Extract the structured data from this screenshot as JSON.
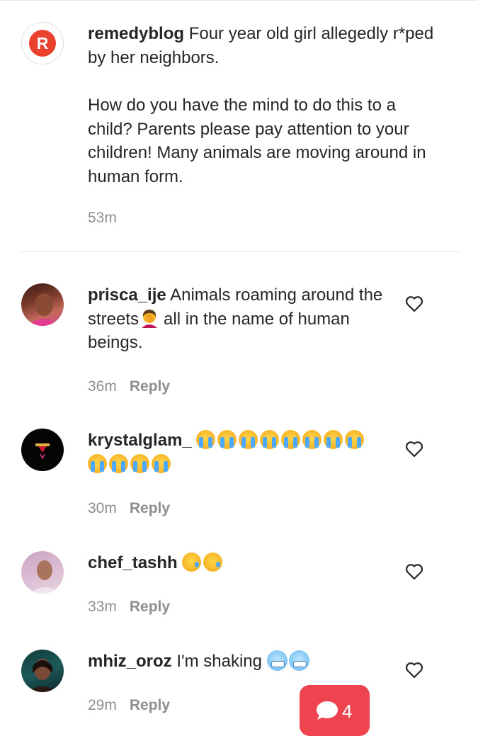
{
  "post": {
    "username": "remedyblog",
    "caption_line1": "Four year old girl allegedly r*ped by her neighbors.",
    "caption_body": "How do you have the mind to do this to a child? Parents please pay attention to your children! Many animals are moving around in human form.",
    "time": "53m",
    "avatar_letter": "R"
  },
  "reply_label": "Reply",
  "comments": [
    {
      "username": "prisca_ije",
      "text_before": "Animals roaming around the streets",
      "text_after": "all in the name of human beings.",
      "time": "36m"
    },
    {
      "username": "krystalglam_",
      "time": "30m"
    },
    {
      "username": "chef_tashh",
      "time": "33m"
    },
    {
      "username": "mhiz_oroz",
      "text": "I'm shaking",
      "time": "29m"
    }
  ],
  "comment_fab": {
    "count": "4",
    "color": "#ee4450"
  }
}
